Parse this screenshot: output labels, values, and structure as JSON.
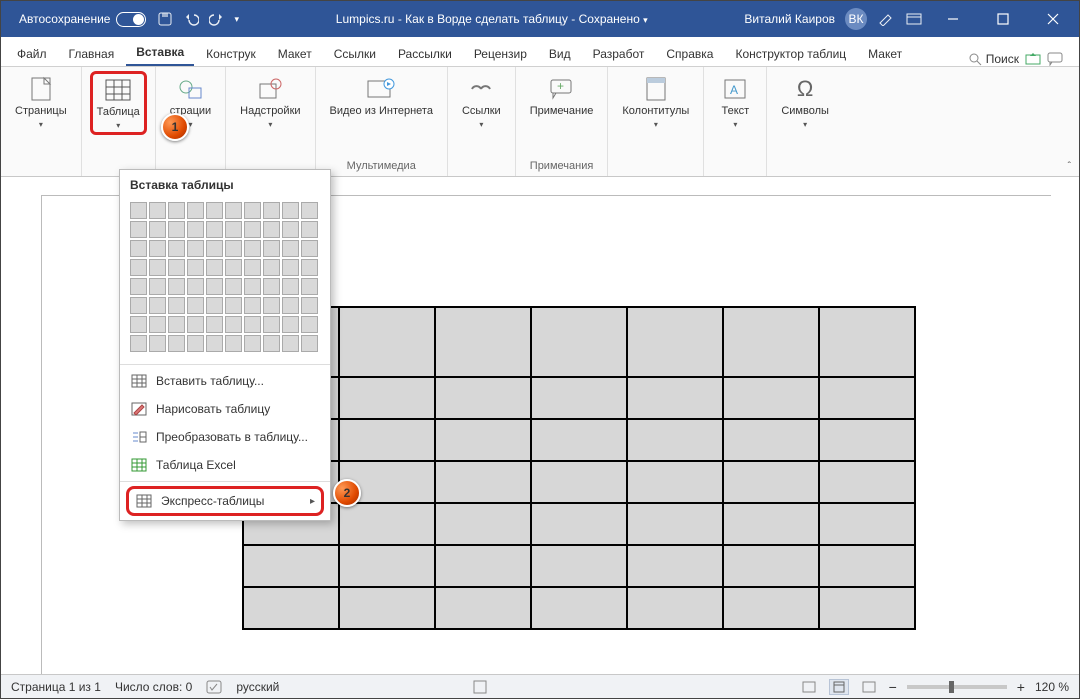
{
  "titlebar": {
    "autosave": "Автосохранение",
    "doc_title": "Lumpics.ru - Как в Ворде сделать таблицу",
    "saved": "Сохранено",
    "user_name": "Виталий Каиров",
    "user_initials": "ВК"
  },
  "tabs": {
    "items": [
      "Файл",
      "Главная",
      "Вставка",
      "Конструк",
      "Макет",
      "Ссылки",
      "Рассылки",
      "Рецензир",
      "Вид",
      "Разработ",
      "Справка",
      "Конструктор таблиц",
      "Макет"
    ],
    "active_index": 2,
    "search_placeholder": "Поиск"
  },
  "ribbon": {
    "pages": {
      "label": "Страницы"
    },
    "table": {
      "label": "Таблица"
    },
    "illustr": {
      "label": "страции",
      "group": ""
    },
    "addins": {
      "label": "Надстройки"
    },
    "video": {
      "label": "Видео из Интернета",
      "group": "Мультимедиа"
    },
    "links": {
      "label": "Ссылки"
    },
    "comment": {
      "label": "Примечание",
      "group": "Примечания"
    },
    "headers": {
      "label": "Колонтитулы"
    },
    "text": {
      "label": "Текст"
    },
    "symbols": {
      "label": "Символы"
    }
  },
  "dropdown": {
    "title": "Вставка таблицы",
    "items": [
      "Вставить таблицу...",
      "Нарисовать таблицу",
      "Преобразовать в таблицу...",
      "Таблица Excel",
      "Экспресс-таблицы"
    ]
  },
  "markers": {
    "m1": "1",
    "m2": "2"
  },
  "statusbar": {
    "page": "Страница 1 из 1",
    "words": "Число слов: 0",
    "lang": "русский",
    "zoom": "120 %"
  }
}
